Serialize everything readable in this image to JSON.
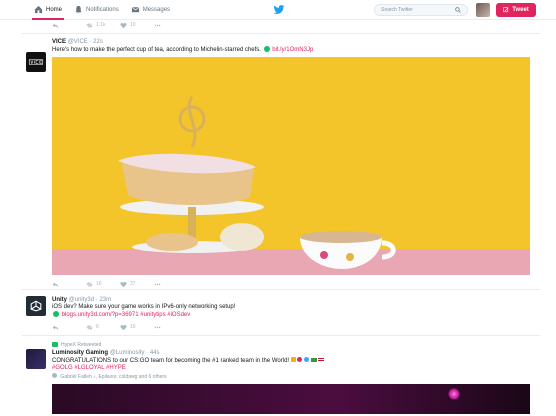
{
  "nav": {
    "home": "Home",
    "notifications": "Notifications",
    "messages": "Messages"
  },
  "search": {
    "placeholder": "Search Twitter"
  },
  "compose": {
    "label": "Tweet"
  },
  "colors": {
    "accent": "#e0245e",
    "verified": "#17bf63",
    "muted": "#8899a6"
  },
  "top_actions": {
    "retweets": "1.1k",
    "likes": "10"
  },
  "tweets": [
    {
      "name": "VICE",
      "handle": "@VICE",
      "time": "22s",
      "text": "Here's how to make the perfect cup of tea, according to Michelin-starred chefs.",
      "link": "bit.ly/1OmN3Jp",
      "retweets": "16",
      "likes": "37"
    },
    {
      "name": "Unity",
      "handle": "@unity3d",
      "time": "23m",
      "text": "iOS dev? Make sure your game works in IPv6-only networking setup!",
      "link": "blogs.unity3d.com/?p=36971 #unitytips #iOSdev",
      "retweets": "6",
      "likes": "16"
    },
    {
      "retweeted_by": "HypeX Retweeted",
      "name": "Luminosity Gaming",
      "handle": "@Luminosity",
      "time": "44s",
      "text": "CONGRATULATIONS to our CS:GO team for becoming the #1 ranked team in the World!",
      "hashtags": "#GOLG #LGLOYAL #HYPE",
      "liked_by": "Gabriel Fatleh ♪, Epilaxor, coldawg and 6 others"
    }
  ]
}
